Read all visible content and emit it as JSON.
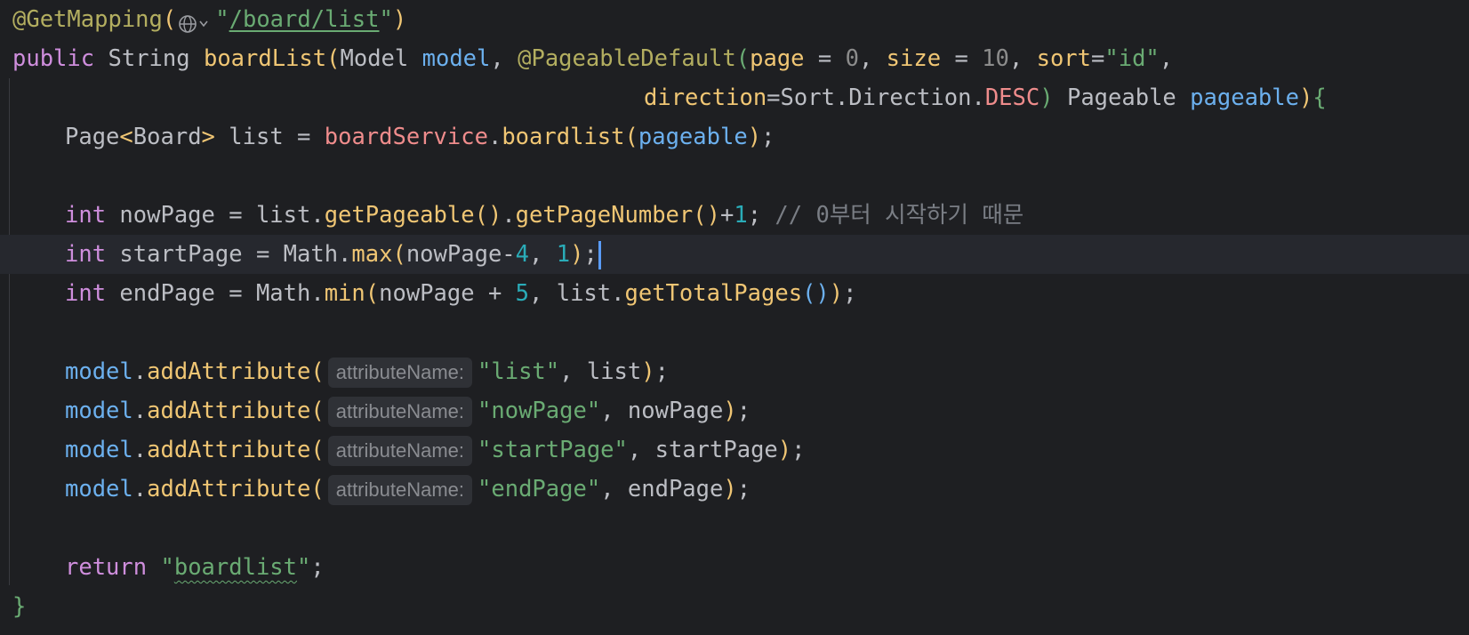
{
  "annotation": {
    "name": "@GetMapping",
    "open": "(",
    "quote_open": "\"",
    "url": "/board/list",
    "quote_close": "\"",
    "close": ")"
  },
  "signature": {
    "modifier": "public",
    "return_type": "String",
    "method": "boardList",
    "paren_open": "(",
    "param1_type": "Model",
    "param1_name": "model",
    "comma": ",",
    "annot2": "@PageableDefault",
    "annot2_open": "(",
    "page_key": "page",
    "eq": " = ",
    "page_val": "0",
    "size_key": "size",
    "size_val": "10",
    "sort_key": "sort",
    "sort_eq": "=",
    "sort_val": "\"id\"",
    "direction_key": "direction",
    "direction_eq": "=",
    "direction_val_a": "Sort.Direction.",
    "direction_val_b": "DESC",
    "annot2_close": ")",
    "param2_type": "Pageable",
    "param2_name": "pageable",
    "paren_close": ")",
    "brace_open": "{"
  },
  "line3": {
    "type_a": "Page",
    "lt": "<",
    "type_b": "Board",
    "gt": ">",
    "var": " list = ",
    "field": "boardService",
    "dot": ".",
    "method": "boardlist",
    "open": "(",
    "arg": "pageable",
    "close": ")",
    "semi": ";"
  },
  "line5": {
    "kw": "int",
    "lhs": " nowPage = list.",
    "m1": "getPageable",
    "p1": "()",
    "dot": ".",
    "m2": "getPageNumber",
    "p2": "()",
    "plus": "+",
    "num": "1",
    "semi": "; ",
    "comment": "// 0부터 시작하기 때문"
  },
  "line6": {
    "kw": "int",
    "lhs": " startPage = Math.",
    "m": "max",
    "open": "(",
    "arg1": "nowPage-",
    "num1": "4",
    "comma": ", ",
    "num2": "1",
    "close": ")",
    "semi": ";"
  },
  "line7": {
    "kw": "int",
    "lhs": " endPage = Math.",
    "m": "min",
    "open": "(",
    "arg1": "nowPage + ",
    "num1": "5",
    "comma": ", list.",
    "m2": "getTotalPages",
    "p2": "()",
    "close": ")",
    "semi": ";"
  },
  "model_calls": [
    {
      "obj": "model",
      "dot": ".",
      "method": "addAttribute",
      "open": "(",
      "hint": "attributeName:",
      "key": "\"list\"",
      "rest": ", list",
      "close": ")",
      "semi": ";"
    },
    {
      "obj": "model",
      "dot": ".",
      "method": "addAttribute",
      "open": "(",
      "hint": "attributeName:",
      "key": "\"nowPage\"",
      "rest": ", nowPage",
      "close": ")",
      "semi": ";"
    },
    {
      "obj": "model",
      "dot": ".",
      "method": "addAttribute",
      "open": "(",
      "hint": "attributeName:",
      "key": "\"startPage\"",
      "rest": ", startPage",
      "close": ")",
      "semi": ";"
    },
    {
      "obj": "model",
      "dot": ".",
      "method": "addAttribute",
      "open": "(",
      "hint": "attributeName:",
      "key": "\"endPage\"",
      "rest": ", endPage",
      "close": ")",
      "semi": ";"
    }
  ],
  "return_line": {
    "kw": "return",
    "q1": " \"",
    "value": "boardlist",
    "q2": "\"",
    "semi": ";"
  },
  "closing_brace": "}",
  "colors": {
    "background": "#1e1f22",
    "current_line": "#26282e",
    "keyword": "#cf8edd",
    "method": "#f0c674",
    "parameter": "#6cb0ee",
    "string": "#6aab73",
    "number": "#2aacb8",
    "comment": "#7a7e85",
    "field": "#ef8c8c",
    "caret": "#5a9cf8"
  },
  "icons": {
    "url_gutter": "globe-icon"
  }
}
